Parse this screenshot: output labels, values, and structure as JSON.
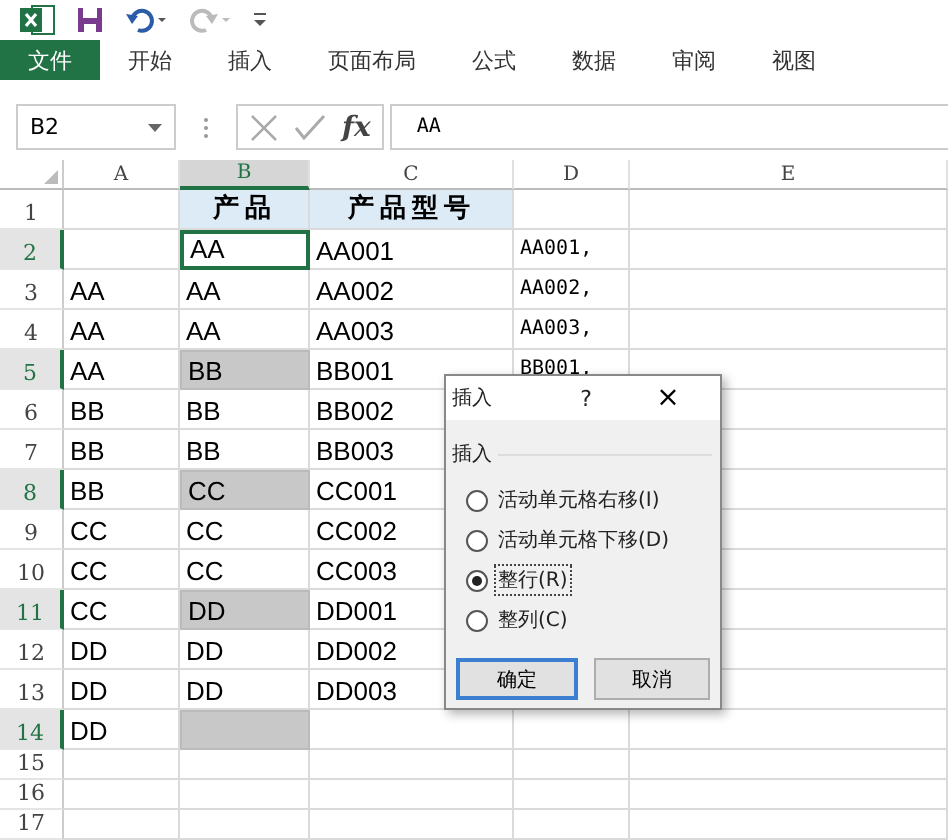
{
  "ribbon": {
    "file_tab": "文件",
    "tabs": [
      "开始",
      "插入",
      "页面布局",
      "公式",
      "数据",
      "审阅",
      "视图"
    ]
  },
  "formula_bar": {
    "name_box": "B2",
    "fx": "fx",
    "value": "AA"
  },
  "sheet": {
    "columns": [
      {
        "label": "A",
        "selected": false
      },
      {
        "label": "B",
        "selected": true
      },
      {
        "label": "C",
        "selected": false
      },
      {
        "label": "D",
        "selected": false
      },
      {
        "label": "E",
        "selected": false
      }
    ],
    "rows": [
      {
        "header": "1",
        "kind": "heading",
        "selected": false,
        "cells": [
          {},
          {
            "text": "产品"
          },
          {
            "text": "产品型号"
          },
          {},
          {}
        ]
      },
      {
        "header": "2",
        "kind": "data",
        "selected": true,
        "cells": [
          {},
          {
            "text": "AA",
            "active": true
          },
          {
            "text": "AA001"
          },
          {
            "text": "AA001,"
          },
          {}
        ]
      },
      {
        "header": "3",
        "kind": "data",
        "selected": false,
        "cells": [
          {
            "text": "AA"
          },
          {
            "text": "AA"
          },
          {
            "text": "AA002"
          },
          {
            "text": "AA002,"
          },
          {}
        ]
      },
      {
        "header": "4",
        "kind": "data",
        "selected": false,
        "cells": [
          {
            "text": "AA"
          },
          {
            "text": "AA"
          },
          {
            "text": "AA003"
          },
          {
            "text": "AA003,"
          },
          {}
        ]
      },
      {
        "header": "5",
        "kind": "data",
        "selected": true,
        "cells": [
          {
            "text": "AA"
          },
          {
            "text": "BB",
            "selected": true
          },
          {
            "text": "BB001"
          },
          {
            "text": "BB001,"
          },
          {}
        ]
      },
      {
        "header": "6",
        "kind": "data",
        "selected": false,
        "cells": [
          {
            "text": "BB"
          },
          {
            "text": "BB"
          },
          {
            "text": "BB002"
          },
          {},
          {}
        ]
      },
      {
        "header": "7",
        "kind": "data",
        "selected": false,
        "cells": [
          {
            "text": "BB"
          },
          {
            "text": "BB"
          },
          {
            "text": "BB003"
          },
          {},
          {}
        ]
      },
      {
        "header": "8",
        "kind": "data",
        "selected": true,
        "cells": [
          {
            "text": "BB"
          },
          {
            "text": "CC",
            "selected": true
          },
          {
            "text": "CC001"
          },
          {},
          {}
        ]
      },
      {
        "header": "9",
        "kind": "data",
        "selected": false,
        "cells": [
          {
            "text": "CC"
          },
          {
            "text": "CC"
          },
          {
            "text": "CC002"
          },
          {},
          {}
        ]
      },
      {
        "header": "10",
        "kind": "data",
        "selected": false,
        "cells": [
          {
            "text": "CC"
          },
          {
            "text": "CC"
          },
          {
            "text": "CC003"
          },
          {},
          {}
        ]
      },
      {
        "header": "11",
        "kind": "data",
        "selected": true,
        "cells": [
          {
            "text": "CC"
          },
          {
            "text": "DD",
            "selected": true
          },
          {
            "text": "DD001"
          },
          {},
          {}
        ]
      },
      {
        "header": "12",
        "kind": "data",
        "selected": false,
        "cells": [
          {
            "text": "DD"
          },
          {
            "text": "DD"
          },
          {
            "text": "DD002"
          },
          {},
          {}
        ]
      },
      {
        "header": "13",
        "kind": "data",
        "selected": false,
        "cells": [
          {
            "text": "DD"
          },
          {
            "text": "DD"
          },
          {
            "text": "DD003"
          },
          {},
          {}
        ]
      },
      {
        "header": "14",
        "kind": "data",
        "selected": true,
        "cells": [
          {
            "text": "DD"
          },
          {
            "selected": true
          },
          {},
          {},
          {}
        ]
      },
      {
        "header": "15",
        "kind": "empty",
        "selected": false,
        "cells": [
          {},
          {},
          {},
          {},
          {}
        ]
      },
      {
        "header": "16",
        "kind": "empty",
        "selected": false,
        "cells": [
          {},
          {},
          {},
          {},
          {}
        ]
      },
      {
        "header": "17",
        "kind": "empty",
        "selected": false,
        "cells": [
          {},
          {},
          {},
          {},
          {}
        ]
      }
    ]
  },
  "dialog": {
    "title": "插入",
    "help": "?",
    "close": "×",
    "group": "插入",
    "options": [
      {
        "label": "活动单元格右移(I)",
        "selected": false
      },
      {
        "label": "活动单元格下移(D)",
        "selected": false
      },
      {
        "label": "整行(R)",
        "selected": true
      },
      {
        "label": "整列(C)",
        "selected": false
      }
    ],
    "buttons": [
      {
        "label": "确定",
        "default": true
      },
      {
        "label": "取消",
        "default": false
      }
    ]
  }
}
